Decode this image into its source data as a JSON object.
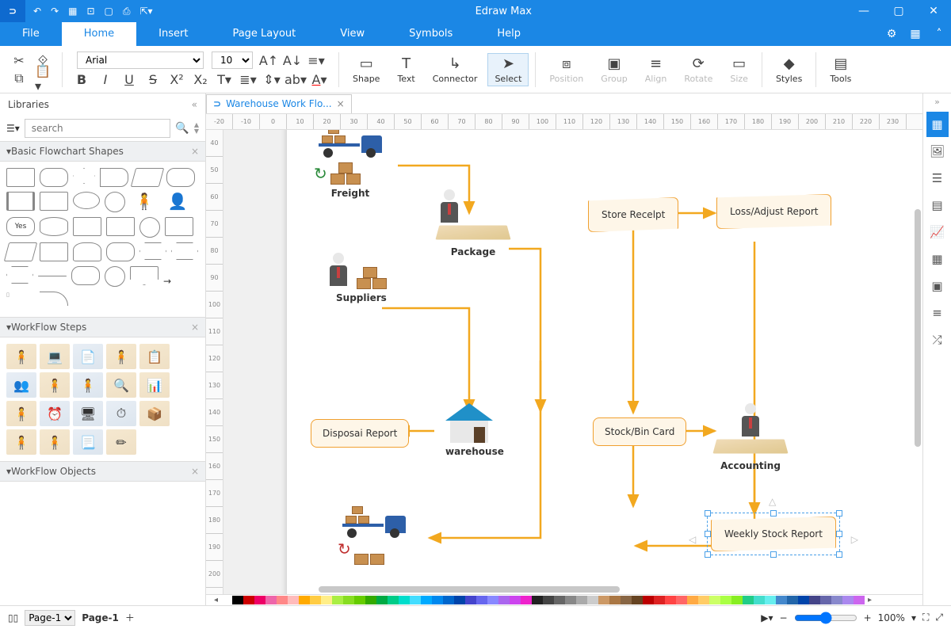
{
  "app": {
    "title": "Edraw Max"
  },
  "menu": {
    "items": [
      "File",
      "Home",
      "Insert",
      "Page Layout",
      "View",
      "Symbols",
      "Help"
    ],
    "active": "Home"
  },
  "ribbon": {
    "font": "Arial",
    "size": "10",
    "tools": {
      "shape": "Shape",
      "text": "Text",
      "connector": "Connector",
      "select": "Select",
      "position": "Position",
      "group": "Group",
      "align": "Align",
      "rotate": "Rotate",
      "size": "Size",
      "styles": "Styles",
      "tools": "Tools"
    }
  },
  "libraries": {
    "title": "Libraries",
    "search_placeholder": "search",
    "panels": {
      "basic": "Basic Flowchart Shapes",
      "steps": "WorkFlow Steps",
      "objects": "WorkFlow Objects"
    }
  },
  "doctab": {
    "name": "Warehouse Work Flo..."
  },
  "ruler_h": [
    "-20",
    "-10",
    "0",
    "10",
    "20",
    "30",
    "40",
    "50",
    "60",
    "70",
    "80",
    "90",
    "100",
    "110",
    "120",
    "130",
    "140",
    "150",
    "160",
    "170",
    "180",
    "190",
    "200",
    "210",
    "220",
    "230"
  ],
  "ruler_v": [
    "40",
    "50",
    "60",
    "70",
    "80",
    "90",
    "100",
    "110",
    "120",
    "130",
    "140",
    "150",
    "160",
    "170",
    "180",
    "190",
    "200"
  ],
  "flow": {
    "freight": "Freight",
    "package": "Package",
    "suppliers": "Suppliers",
    "warehouse": "warehouse",
    "disposal": "Disposai Report",
    "store_receipt": "Store Recelpt",
    "loss_adjust": "Loss/Adjust Report",
    "stock_bin": "Stock/Bin Card",
    "accounting": "Accounting",
    "weekly": "Weekly Stock Report"
  },
  "status": {
    "page_sel": "Page-1",
    "page_tab": "Page-1",
    "zoom": "100%"
  }
}
